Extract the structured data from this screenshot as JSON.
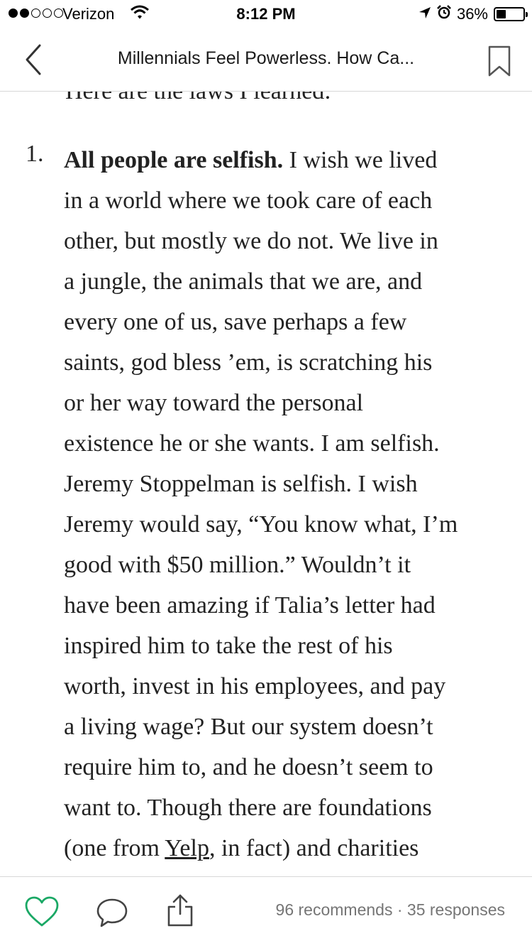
{
  "status_bar": {
    "carrier": "Verizon",
    "time": "8:12 PM",
    "battery_percent": "36%",
    "battery_level": 0.36,
    "signal_bars_filled": 2,
    "signal_bars_total": 5,
    "icons": [
      "wifi-icon",
      "location-arrow-icon",
      "alarm-clock-icon",
      "battery-icon"
    ]
  },
  "nav": {
    "title": "Millennials Feel Powerless. How Ca...",
    "icons": {
      "back": "chevron-left-icon",
      "bookmark": "bookmark-icon"
    }
  },
  "article": {
    "cut_line": "Here are the laws I learned:",
    "list_number": "1.",
    "bold_lead": "All people are selfish.",
    "text_1": " I wish we lived\nin a world where we took care of each\nother, but mostly we do not. We live in\na jungle, the animals that we are, and\nevery one of us, save perhaps a few\nsaints, god bless ’em, is scratching his\nor her way toward the personal\nexistence he or she wants. I am selfish.\nJeremy Stoppelman is selfish. I wish\nJeremy would say, “You know what, I’m\ngood with $50 million.” Wouldn’t it\nhave been amazing if Talia’s letter had\ninspired him to take the rest of his\nworth, invest in his employees, and pay\na living wage? But our system doesn’t\nrequire him to, and he doesn’t seem to\nwant to. Though there are foundations\n(one from ",
    "link_text": "Yelp",
    "text_2": ", in fact) and charities\nand prizes, I’ve found that when"
  },
  "toolbar": {
    "recommends": "96 recommends",
    "separator": " · ",
    "responses": "35 responses",
    "icons": {
      "recommend": "heart-icon",
      "respond": "comment-bubble-icon",
      "share": "share-icon"
    },
    "colors": {
      "heart": "#1aa865",
      "counts": "#757575"
    }
  }
}
